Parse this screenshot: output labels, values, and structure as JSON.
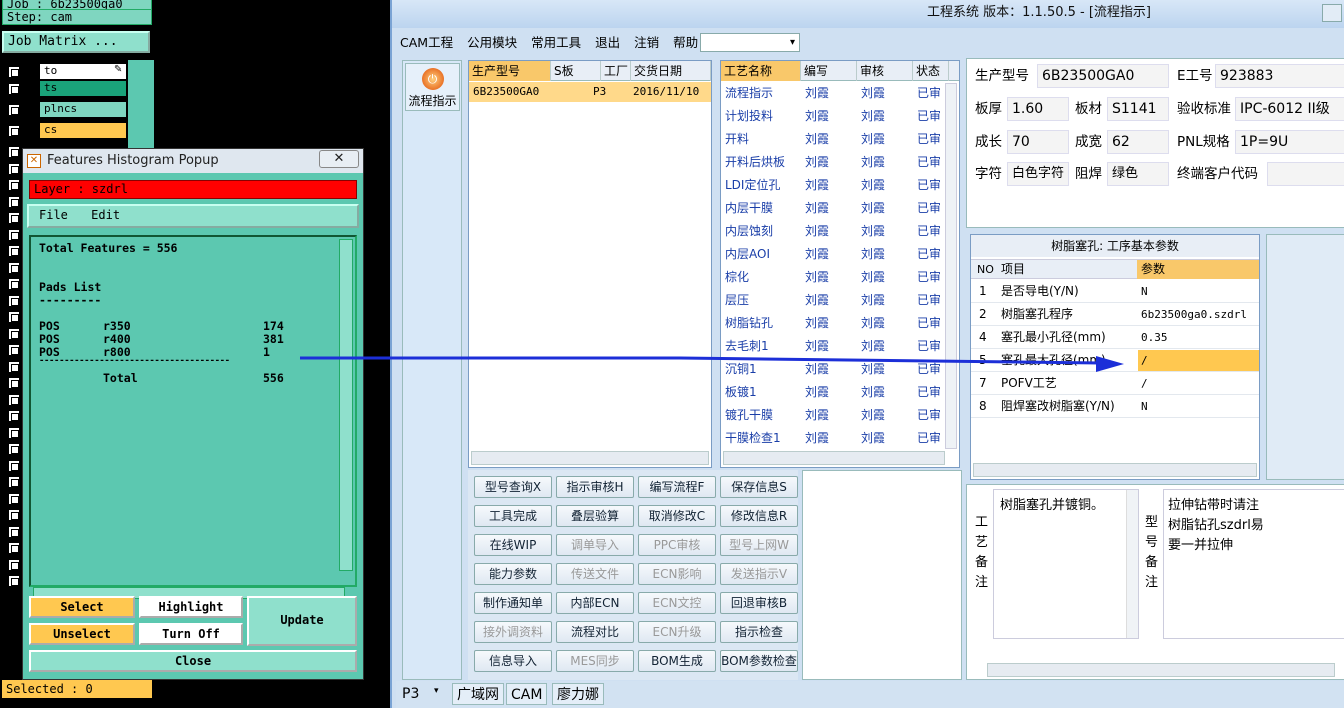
{
  "genesis": {
    "job_line": "Job : 6b23500ga0",
    "step_line": "Step: cam",
    "job_matrix_label": "Job Matrix ...",
    "layers": [
      {
        "name": "to",
        "color": "#ffffff"
      },
      {
        "name": "ts",
        "color": "#1aa37a"
      },
      {
        "name": "plncs",
        "color": "#7fd6c0"
      },
      {
        "name": "cs",
        "color": "#ffc850"
      }
    ],
    "selected_status": "Selected : 0"
  },
  "popup": {
    "title": "Features Histogram Popup",
    "close_label": "✕",
    "layer_line": "Layer :  szdrl",
    "menu": [
      "File",
      "Edit"
    ],
    "total_line": "Total Features = 556",
    "pads_header": "Pads List",
    "pads_underline": "---------",
    "rows": [
      {
        "type": "POS",
        "symbol": "r350",
        "count": "174"
      },
      {
        "type": "POS",
        "symbol": "r400",
        "count": "381"
      },
      {
        "type": "POS",
        "symbol": "r800",
        "count": "1"
      }
    ],
    "divider": "--------------------------------------",
    "total_label": "Total",
    "total_value": "556",
    "buttons": {
      "select": "Select",
      "highlight": "Highlight",
      "update": "Update",
      "unselect": "Unselect",
      "turn_off": "Turn Off",
      "close": "Close"
    }
  },
  "main": {
    "title": "工程系统   版本：1.1.50.5 - [流程指示]",
    "menu": [
      "CAM工程",
      "公用模块",
      "常用工具",
      "退出",
      "注销",
      "帮助"
    ],
    "sidebar_button": "流程指示",
    "sidebar_icon_char": "⏻",
    "orders": {
      "headers": [
        "生产型号",
        "S板",
        "工厂",
        "交货日期"
      ],
      "rows": [
        [
          "6B23500GA0",
          "",
          "P3",
          "2016/11/10"
        ]
      ]
    },
    "process": {
      "headers": [
        "工艺名称",
        "编写",
        "审核",
        "状态"
      ],
      "rows": [
        [
          "流程指示",
          "刘霞",
          "刘霞",
          "已审"
        ],
        [
          "计划投料",
          "刘霞",
          "刘霞",
          "已审"
        ],
        [
          "开料",
          "刘霞",
          "刘霞",
          "已审"
        ],
        [
          "开料后烘板",
          "刘霞",
          "刘霞",
          "已审"
        ],
        [
          "LDI定位孔",
          "刘霞",
          "刘霞",
          "已审"
        ],
        [
          "内层干膜",
          "刘霞",
          "刘霞",
          "已审"
        ],
        [
          "内层蚀刻",
          "刘霞",
          "刘霞",
          "已审"
        ],
        [
          "内层AOI",
          "刘霞",
          "刘霞",
          "已审"
        ],
        [
          "棕化",
          "刘霞",
          "刘霞",
          "已审"
        ],
        [
          "层压",
          "刘霞",
          "刘霞",
          "已审"
        ],
        [
          "树脂钻孔",
          "刘霞",
          "刘霞",
          "已审"
        ],
        [
          "去毛刺1",
          "刘霞",
          "刘霞",
          "已审"
        ],
        [
          "沉铜1",
          "刘霞",
          "刘霞",
          "已审"
        ],
        [
          "板镀1",
          "刘霞",
          "刘霞",
          "已审"
        ],
        [
          "镀孔干膜",
          "刘霞",
          "刘霞",
          "已审"
        ],
        [
          "干膜检查1",
          "刘霞",
          "刘霞",
          "已审"
        ]
      ]
    },
    "buttons": [
      [
        "型号查询X",
        "指示审核H",
        "编写流程F",
        "保存信息S"
      ],
      [
        "工具完成",
        "叠层验算",
        "取消修改C",
        "修改信息R"
      ],
      [
        "在线WIP",
        "调单导入",
        "PPC审核",
        "型号上网W"
      ],
      [
        "能力参数",
        "传送文件",
        "ECN影响",
        "发送指示V"
      ],
      [
        "制作通知单",
        "内部ECN",
        "ECN文控",
        "回退审核B"
      ],
      [
        "接外调资料",
        "流程对比",
        "ECN升级",
        "指示检查"
      ],
      [
        "信息导入",
        "MES同步",
        "BOM生成",
        "BOM参数检查"
      ]
    ],
    "disabled_buttons": [
      "调单导入",
      "PPC审核",
      "型号上网W",
      "传送文件",
      "ECN影响",
      "发送指示V",
      "ECN文控",
      "接外调资料",
      "ECN升级",
      "MES同步"
    ],
    "info": {
      "model_label": "生产型号",
      "model_value": "6B23500GA0",
      "eno_label": "E工号",
      "eno_value": "923883",
      "thick_label": "板厚",
      "thick_value": "1.60",
      "material_label": "板材",
      "material_value": "S1141",
      "standard_label": "验收标准",
      "standard_value": "IPC-6012 II级",
      "len_label": "成长",
      "len_value": "70",
      "width_label": "成宽",
      "width_value": "62",
      "pnl_label": "PNL规格",
      "pnl_value": "1P=9U",
      "char_label": "字符",
      "char_value": "白色字符",
      "mask_label": "阻焊",
      "mask_value": "绿色",
      "customer_label": "终端客户代码",
      "customer_value": ""
    },
    "params": {
      "title": "树脂塞孔: 工序基本参数",
      "headers": [
        "NO",
        "项目",
        "参数"
      ],
      "rows": [
        [
          "1",
          "是否导电(Y/N)",
          "N"
        ],
        [
          "2",
          "树脂塞孔程序",
          "6b23500ga0.szdrl"
        ],
        [
          "4",
          "塞孔最小孔径(mm)",
          "0.35"
        ],
        [
          "5",
          "塞孔最大孔径(mm)",
          "/"
        ],
        [
          "7",
          "POFV工艺",
          "/"
        ],
        [
          "8",
          "阻焊塞改树脂塞(Y/N)",
          "N"
        ]
      ]
    },
    "remarks": {
      "process_label": "工艺备注",
      "process_text": "树脂塞孔并镀铜。",
      "model_label": "型号备注",
      "model_lines": [
        "拉伸钻带时请注",
        "树脂钻孔szdrl易",
        "要一并拉伸"
      ]
    },
    "bottom_tabs": [
      "P3",
      "广域网",
      "CAM",
      "廖力娜"
    ],
    "accent_color": "#ffc850",
    "arrow_color": "#1c2fd8"
  }
}
